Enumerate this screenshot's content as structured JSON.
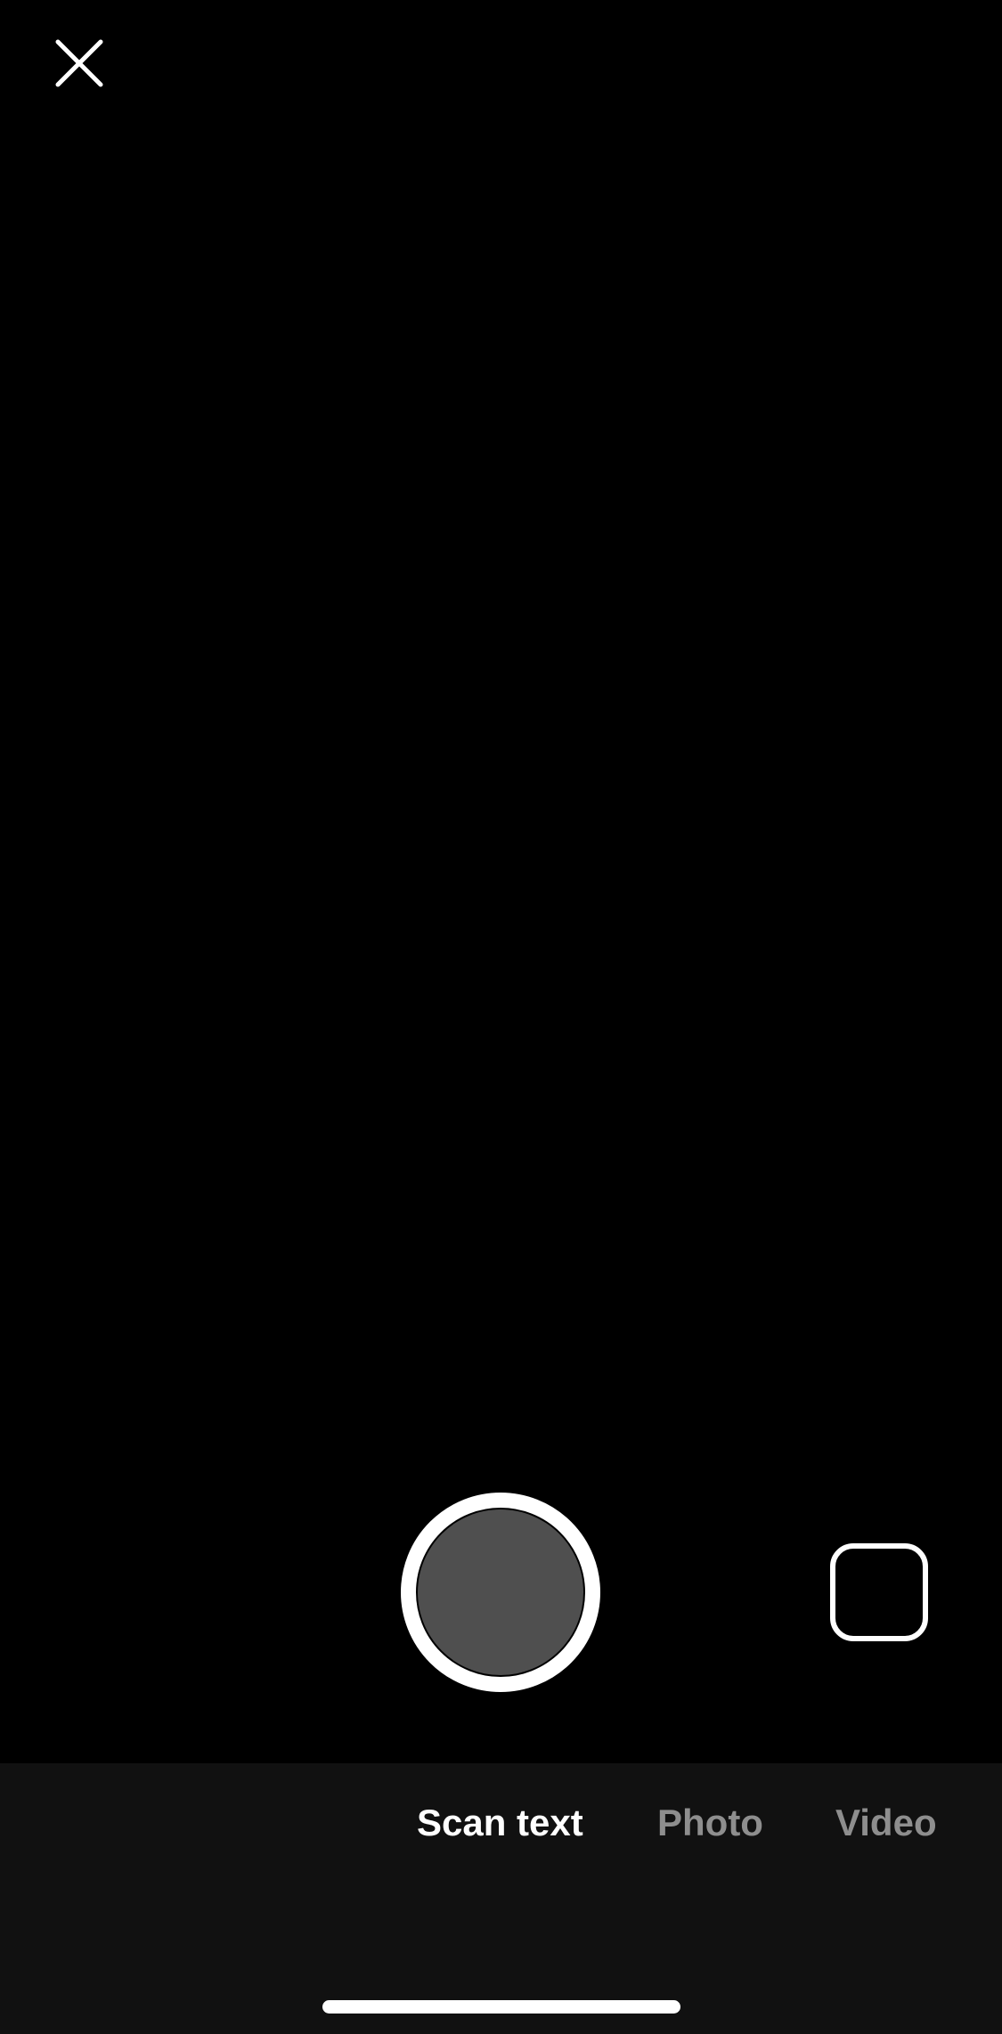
{
  "header": {
    "close_icon": "close-icon"
  },
  "capture": {
    "shutter_icon": "shutter-button",
    "gallery_icon": "gallery-thumbnail-icon"
  },
  "modes": {
    "items": [
      {
        "label": "Scan text",
        "selected": true
      },
      {
        "label": "Photo",
        "selected": false
      },
      {
        "label": "Video",
        "selected": false
      }
    ]
  },
  "colors": {
    "background": "#000000",
    "mode_bar": "#111111",
    "active_mode": "#ffffff",
    "inactive_mode": "#8e8e8e",
    "shutter_fill": "#4f4f4f"
  }
}
